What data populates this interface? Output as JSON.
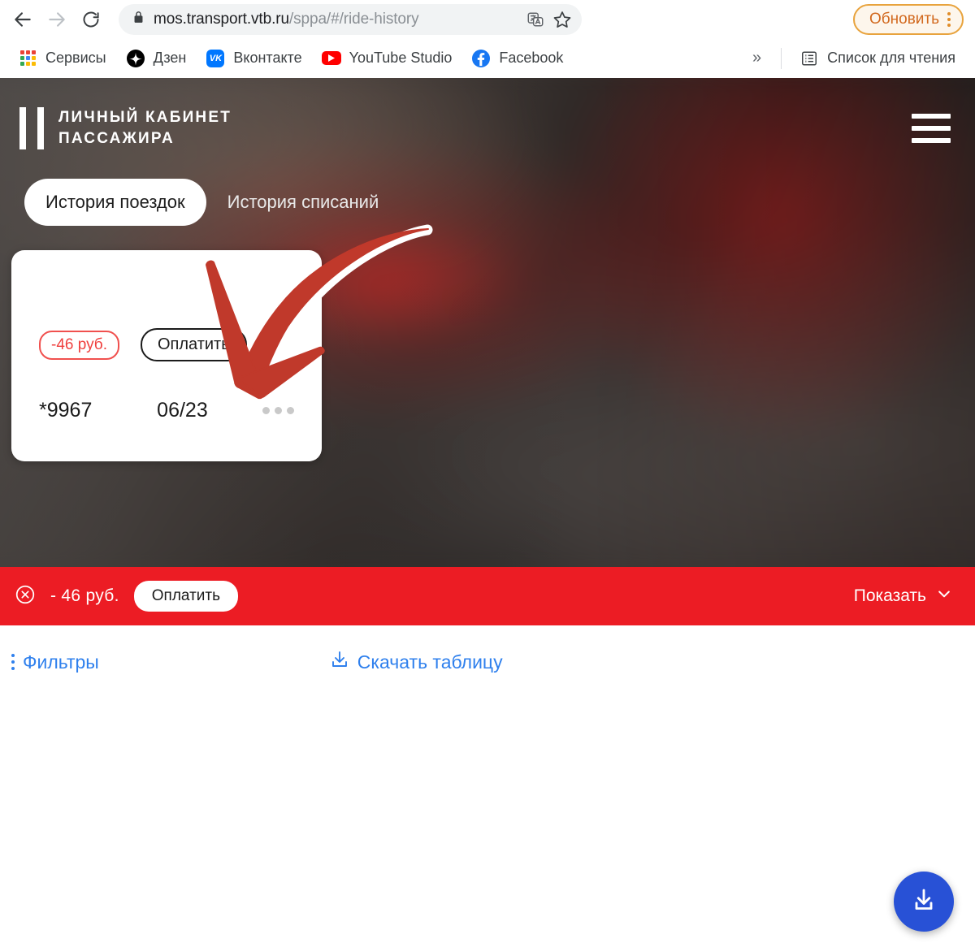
{
  "browser": {
    "back_icon": "back-arrow-icon",
    "forward_icon": "forward-arrow-icon",
    "reload_icon": "reload-icon",
    "lock_icon": "lock-icon",
    "url_domain": "mos.transport.vtb.ru",
    "url_path": "/sppa/#/ride-history",
    "translate_icon": "translate-icon",
    "bookmark_icon": "star-icon",
    "update_button_label": "Обновить",
    "menu_icon": "kebab-menu-icon",
    "bookmarks": [
      {
        "label": "Сервисы",
        "icon": "google-apps-grid-icon"
      },
      {
        "label": "Дзен",
        "icon": "dzen-icon"
      },
      {
        "label": "Вконтакте",
        "icon": "vk-icon"
      },
      {
        "label": "YouTube Studio",
        "icon": "youtube-icon"
      },
      {
        "label": "Facebook",
        "icon": "facebook-icon"
      }
    ],
    "overflow_label": "»",
    "reading_list_label": "Список для чтения",
    "reading_list_icon": "reading-list-icon"
  },
  "app": {
    "logo_line1": "ЛИЧНЫЙ КАБИНЕТ",
    "logo_line2": "ПАССАЖИРА",
    "burger_icon": "hamburger-menu-icon",
    "tabs": [
      {
        "label": "История поездок",
        "active": true
      },
      {
        "label": "История списаний",
        "active": false
      }
    ],
    "card": {
      "amount_badge": "-46 руб.",
      "pay_button": "Оплатить",
      "card_number": "*9967",
      "expiry": "06/23",
      "more_icon": "more-dots-icon"
    },
    "add_card_fab_icon": "plus-icon",
    "carousel_dot": "carousel-indicator-dot"
  },
  "alert": {
    "close_icon": "circle-x-icon",
    "amount": "- 46  руб.",
    "pay_button": "Оплатить",
    "show_label": "Показать",
    "chevron_icon": "chevron-down-icon",
    "color": "#ec1c24"
  },
  "content": {
    "filters_label": "Фильтры",
    "filters_icon": "vertical-dots-icon",
    "download_table_label": "Скачать таблицу",
    "download_table_icon": "download-icon",
    "download_fab_icon": "download-icon",
    "link_color": "#2f80ed"
  }
}
